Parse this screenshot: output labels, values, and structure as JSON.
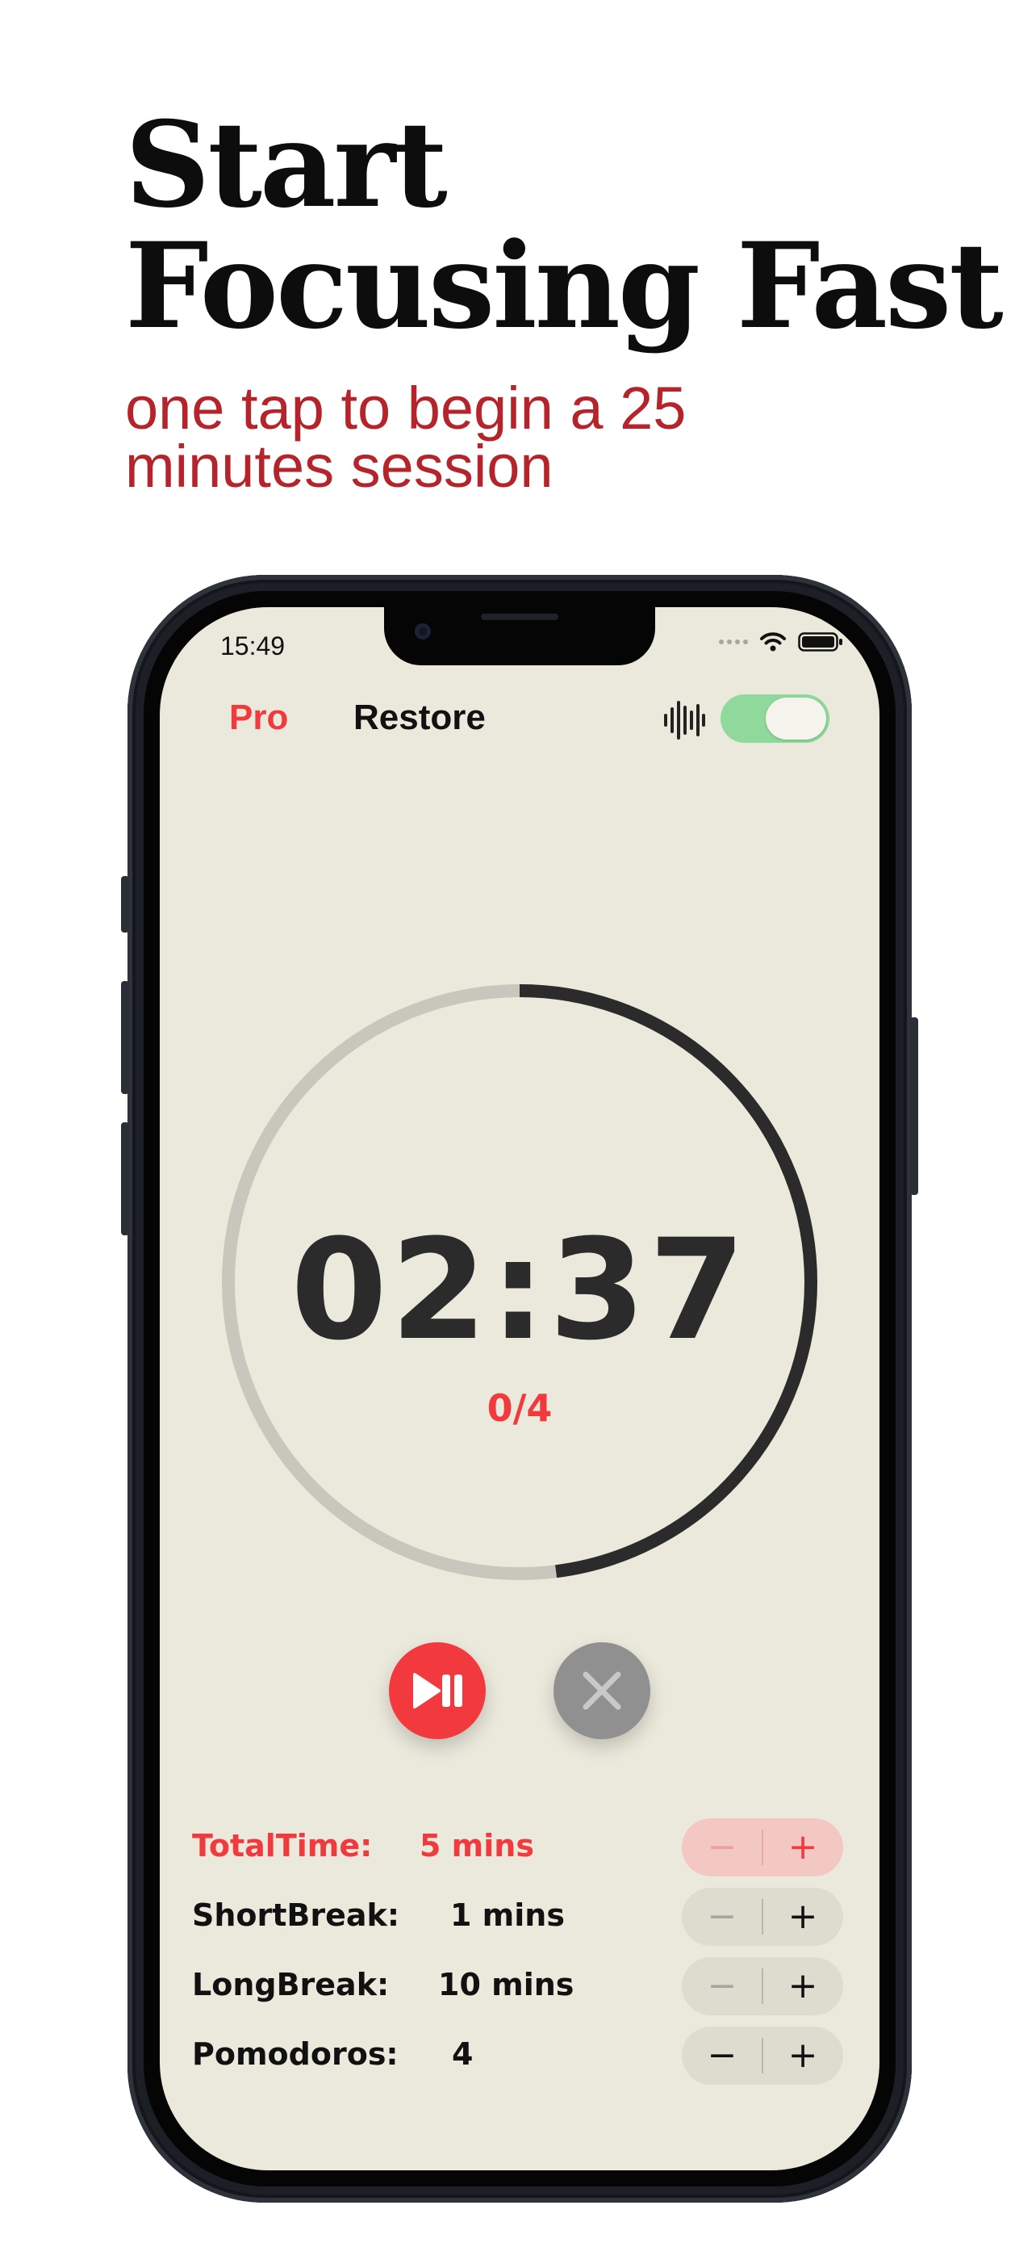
{
  "marketing": {
    "headline_line1": "Start",
    "headline_line2": "Focusing Fast",
    "subline_line1": "one tap to begin a 25",
    "subline_line2": "minutes session"
  },
  "status_bar": {
    "time": "15:49"
  },
  "top_bar": {
    "pro_label": "Pro",
    "restore_label": "Restore",
    "sound_toggle_on": true
  },
  "timer": {
    "display": "02:37",
    "session_count": "0/4",
    "progress_fraction": 0.48
  },
  "controls": {
    "play_pause_icon": "play-pause-icon",
    "cancel_icon": "close-icon"
  },
  "settings": {
    "total_time": {
      "label": "TotalTime:",
      "value": "5 mins",
      "minus": "−",
      "plus": "+"
    },
    "short_break": {
      "label": "ShortBreak:",
      "value": "1 mins",
      "minus": "−",
      "plus": "+"
    },
    "long_break": {
      "label": "LongBreak:",
      "value": "10 mins",
      "minus": "−",
      "plus": "+"
    },
    "pomodoros": {
      "label": "Pomodoros:",
      "value": "4",
      "minus": "−",
      "plus": "+"
    }
  },
  "colors": {
    "accent_red": "#f03a3e",
    "subline_red": "#b5242a",
    "screen_background": "#ebe8dc",
    "toggle_green": "#8fd99c",
    "ring_track": "#c9c6bd",
    "ring_progress": "#2b2b2b"
  }
}
